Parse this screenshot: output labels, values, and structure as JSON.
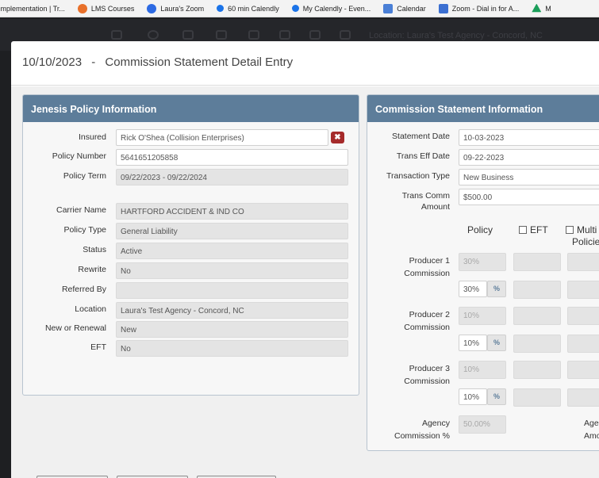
{
  "bookmarks": [
    {
      "label": "Implementation | Tr...",
      "icon": "implementation-icon",
      "color": ""
    },
    {
      "label": "LMS Courses",
      "icon": "lms-icon",
      "color": "#e8702a"
    },
    {
      "label": "Laura's Zoom",
      "icon": "zoom-icon",
      "color": "#2d6ae3"
    },
    {
      "label": "60 min Calendly",
      "icon": "calendly-icon",
      "color": "#1a73e8"
    },
    {
      "label": "My Calendly - Even...",
      "icon": "calendly-icon",
      "color": "#1a73e8"
    },
    {
      "label": "Calendar",
      "icon": "calendar-icon",
      "color": "#4a7fd6"
    },
    {
      "label": "Zoom - Dial in for A...",
      "icon": "zoom-doc-icon",
      "color": "#3b6fd1"
    },
    {
      "label": "M",
      "icon": "drive-icon",
      "color": "#1b9e5a"
    }
  ],
  "app": {
    "location_text": "Location: Laura's Test Agency - Concord, NC"
  },
  "modal": {
    "date": "10/10/2023",
    "separator": "-",
    "title": "Commission Statement Detail Entry"
  },
  "policy_panel": {
    "title": "Jenesis Policy Information",
    "insured_label": "Insured",
    "insured_value": "Rick  O'Shea (Collision Enterprises)",
    "clear_label": "✖",
    "policy_number_label": "Policy Number",
    "policy_number_value": "5641651205858",
    "policy_term_label": "Policy Term",
    "policy_term_value": "09/22/2023 - 09/22/2024",
    "carrier_label": "Carrier Name",
    "carrier_value": "HARTFORD ACCIDENT & IND CO",
    "policy_type_label": "Policy Type",
    "policy_type_value": "General Liability",
    "status_label": "Status",
    "status_value": "Active",
    "rewrite_label": "Rewrite",
    "rewrite_value": "No",
    "referred_label": "Referred By",
    "referred_value": "",
    "location_label": "Location",
    "location_value": "Laura's Test Agency - Concord, NC",
    "new_renewal_label": "New or Renewal",
    "new_renewal_value": "New",
    "eft_label": "EFT",
    "eft_value": "No"
  },
  "commission_panel": {
    "title": "Commission Statement Information",
    "statement_date_label": "Statement Date",
    "statement_date_value": "10-03-2023",
    "trans_eff_date_label": "Trans Eff Date",
    "trans_eff_date_value": "09-22-2023",
    "transaction_type_label": "Transaction Type",
    "transaction_type_value": "New Business",
    "trans_comm_label_1": "Trans Comm",
    "trans_comm_label_2": "Amount",
    "trans_comm_value": "$500.00",
    "policy_col": "Policy",
    "eft_col": "EFT",
    "multi_col_1": "Multi",
    "multi_col_2": "Policies",
    "pct_symbol": "%",
    "producers": [
      {
        "label_1": "Producer 1",
        "label_2": "Commission",
        "policy_value": "30%",
        "edit_value": "30%"
      },
      {
        "label_1": "Producer 2",
        "label_2": "Commission",
        "policy_value": "10%",
        "edit_value": "10%"
      },
      {
        "label_1": "Producer 3",
        "label_2": "Commission",
        "policy_value": "10%",
        "edit_value": "10%"
      }
    ],
    "agency_label_1": "Agency",
    "agency_label_2": "Commission %",
    "agency_value": "50.00%",
    "agency_right_1": "Agen",
    "agency_right_2": "Amo"
  }
}
